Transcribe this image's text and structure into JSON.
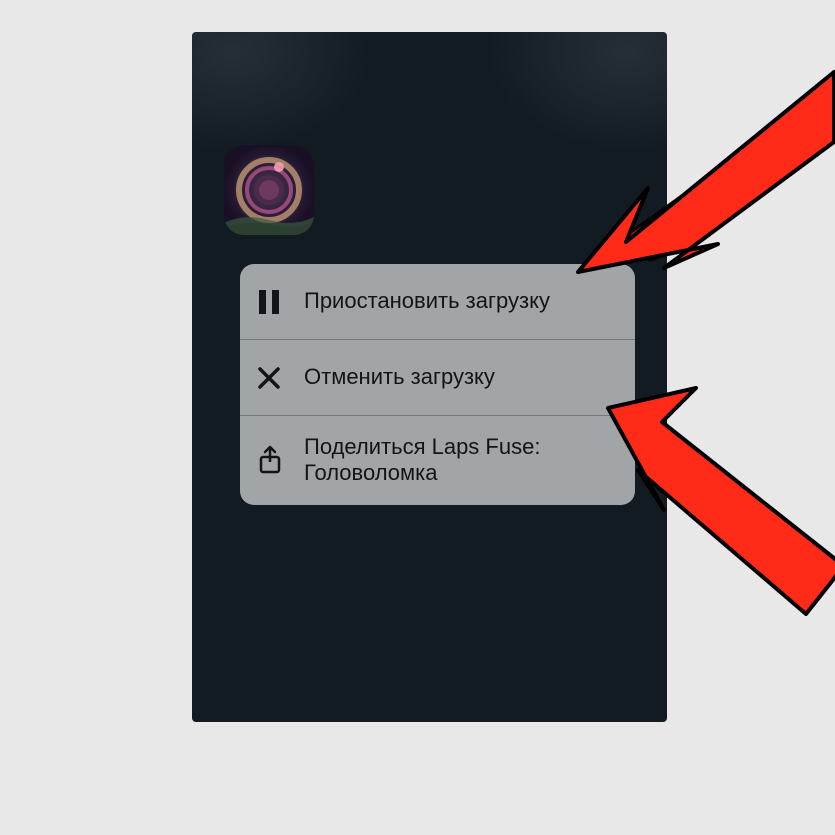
{
  "menu": {
    "items": [
      {
        "icon": "pause",
        "label": "Приостановить загрузку"
      },
      {
        "icon": "close",
        "label": "Отменить загрузку"
      },
      {
        "icon": "share",
        "label": "Поделиться Laps Fuse: Головоломка"
      }
    ]
  },
  "annotation_color": "#ff2a17"
}
